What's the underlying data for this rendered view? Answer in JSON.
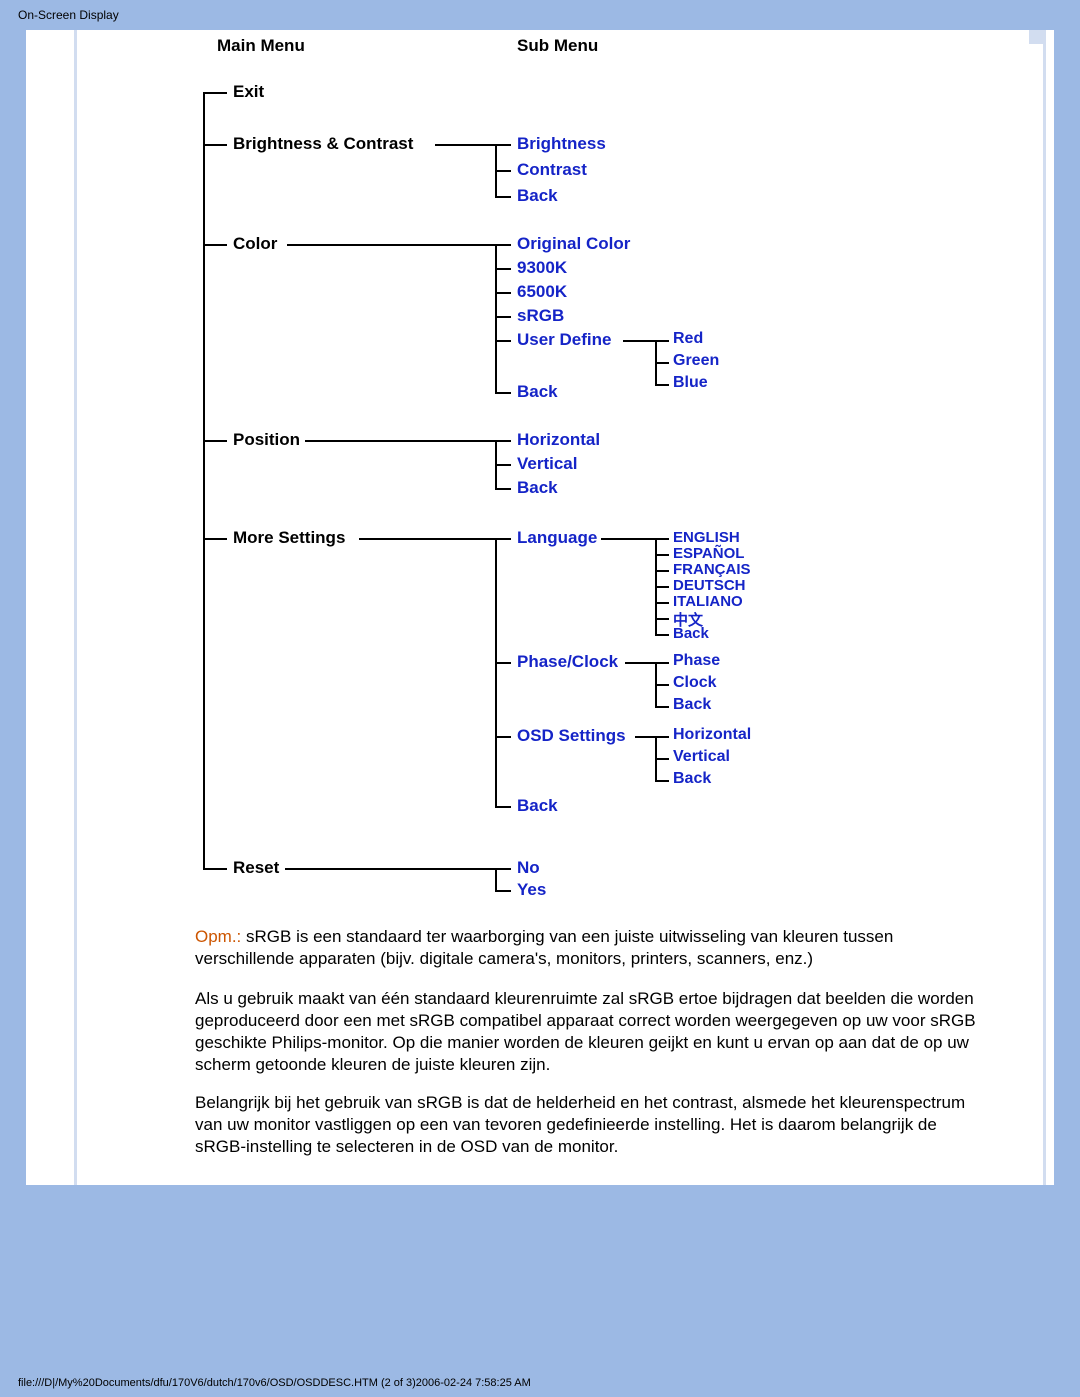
{
  "page_title": "On-Screen Display",
  "headers": {
    "main": "Main Menu",
    "sub": "Sub Menu"
  },
  "main_items": {
    "exit": "Exit",
    "brightness": "Brightness & Contrast",
    "color": "Color",
    "position": "Position",
    "more": "More Settings",
    "reset": "Reset"
  },
  "sub": {
    "bc": {
      "brightness": "Brightness",
      "contrast": "Contrast",
      "back": "Back"
    },
    "color": {
      "orig": "Original Color",
      "9300": "9300K",
      "6500": "6500K",
      "srgb": "sRGB",
      "user": "User Define",
      "back": "Back"
    },
    "user_rgb": {
      "red": "Red",
      "green": "Green",
      "blue": "Blue"
    },
    "position": {
      "h": "Horizontal",
      "v": "Vertical",
      "back": "Back"
    },
    "more": {
      "lang": "Language",
      "phase": "Phase/Clock",
      "osd": "OSD Settings",
      "back": "Back"
    },
    "lang_opts": {
      "en": "ENGLISH",
      "es": "ESPAÑOL",
      "fr": "FRANÇAIS",
      "de": "DEUTSCH",
      "it": "ITALIANO",
      "cn": "中文",
      "back": "Back"
    },
    "phase_opts": {
      "phase": "Phase",
      "clock": "Clock",
      "back": "Back"
    },
    "osd_opts": {
      "h": "Horizontal",
      "v": "Vertical",
      "back": "Back"
    },
    "reset": {
      "no": "No",
      "yes": "Yes"
    }
  },
  "note_label": "Opm.:",
  "note_text": " sRGB is een standaard ter waarborging van een juiste uitwisseling van kleuren tussen verschillende apparaten (bijv. digitale camera's, monitors, printers, scanners, enz.)",
  "para2": "Als u gebruik maakt van één standaard kleurenruimte zal sRGB ertoe bijdragen dat beelden die worden geproduceerd door een met sRGB compatibel apparaat correct worden weergegeven op uw voor sRGB geschikte Philips-monitor. Op die manier worden de kleuren geijkt en kunt u ervan op aan dat de op uw scherm getoonde kleuren de juiste kleuren zijn.",
  "para3": "Belangrijk bij het gebruik van sRGB is dat de helderheid en het contrast, alsmede het kleurenspectrum van uw monitor vastliggen op een van tevoren gedefinieerde instelling. Het is daarom belangrijk de sRGB-instelling te selecteren in de OSD van de monitor.",
  "footer": "file:///D|/My%20Documents/dfu/170V6/dutch/170v6/OSD/OSDDESC.HTM (2 of 3)2006-02-24 7:58:25 AM"
}
